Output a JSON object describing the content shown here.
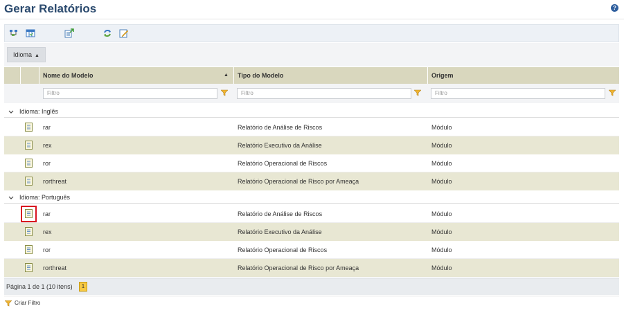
{
  "page": {
    "title": "Gerar Relatórios",
    "help_label": "?"
  },
  "toolbar": {
    "icons": [
      "group-by-icon",
      "columns-icon",
      "export-icon",
      "refresh-icon",
      "edit-icon"
    ]
  },
  "grouping": {
    "chip_label": "Idioma",
    "sort_arrow": "▲"
  },
  "columns": {
    "name": "Nome do Modelo",
    "name_sort": "▲",
    "type": "Tipo do Modelo",
    "origin": "Origem"
  },
  "filters": {
    "placeholder": "Filtro"
  },
  "groups": [
    {
      "label": "Idioma: Inglês",
      "rows": [
        {
          "name": "rar",
          "type": "Relatório de Análise de Riscos",
          "origin": "Módulo"
        },
        {
          "name": "rex",
          "type": "Relatório Executivo da Análise",
          "origin": "Módulo"
        },
        {
          "name": "ror",
          "type": "Relatório Operacional de Riscos",
          "origin": "Módulo"
        },
        {
          "name": "rorthreat",
          "type": "Relatório Operacional de Risco por Ameaça",
          "origin": "Módulo"
        }
      ]
    },
    {
      "label": "Idioma: Português",
      "rows": [
        {
          "name": "rar",
          "type": "Relatório de Análise de Riscos",
          "origin": "Módulo"
        },
        {
          "name": "rex",
          "type": "Relatório Executivo da Análise",
          "origin": "Módulo"
        },
        {
          "name": "ror",
          "type": "Relatório Operacional de Riscos",
          "origin": "Módulo"
        },
        {
          "name": "rorthreat",
          "type": "Relatório Operacional de Risco por Ameaça",
          "origin": "Módulo"
        }
      ]
    }
  ],
  "pager": {
    "text": "Página 1 de 1 (10 itens)",
    "current_page": "1"
  },
  "footer": {
    "create_filter": "Criar Filtro"
  },
  "colors": {
    "accent": "#2b4a6e",
    "header_bg": "#d9d7be",
    "alt_row": "#e8e7d3",
    "highlight": "#d9121f"
  }
}
